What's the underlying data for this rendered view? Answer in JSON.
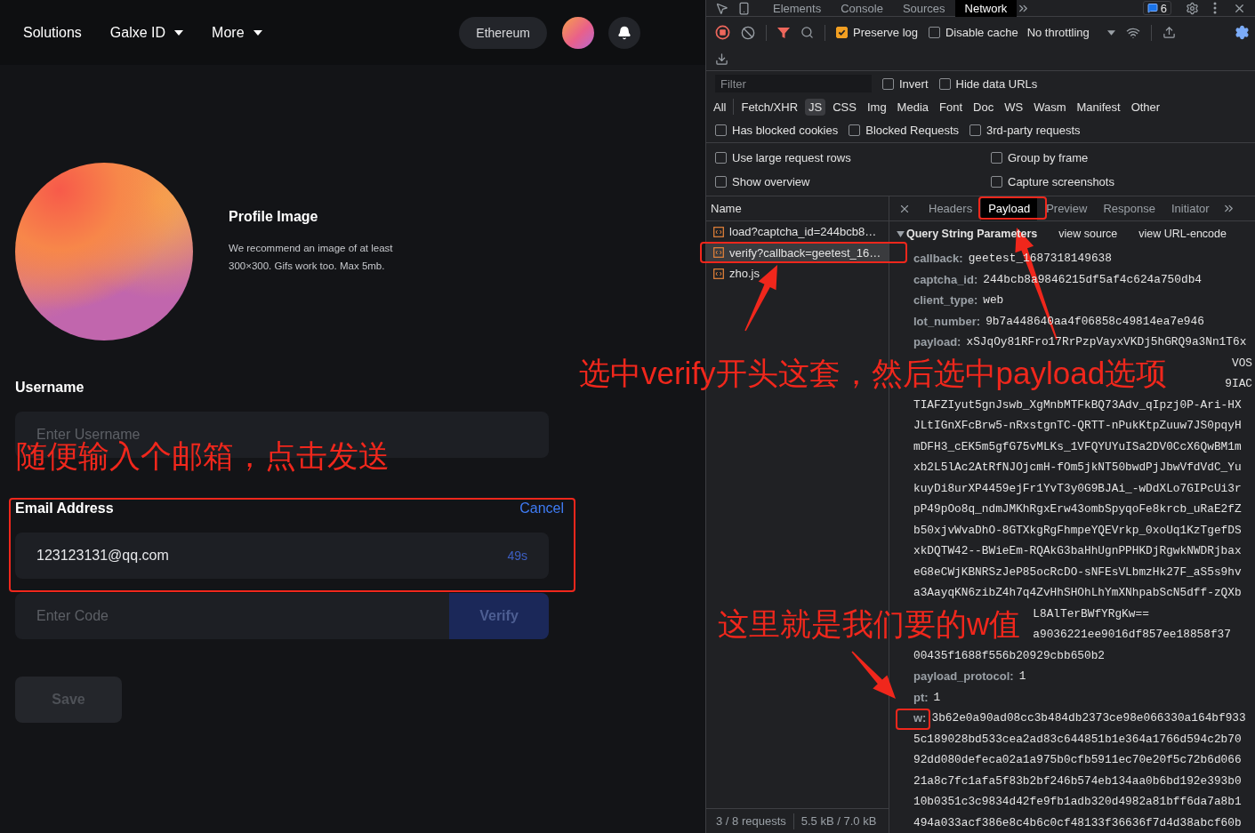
{
  "nav": {
    "links": [
      {
        "label": "Solutions",
        "dropdown": false
      },
      {
        "label": "Galxe ID",
        "dropdown": true
      },
      {
        "label": "More",
        "dropdown": true
      }
    ],
    "network": "Ethereum"
  },
  "profile": {
    "title": "Profile Image",
    "description": "We recommend an image of at least 300×300. Gifs work too. Max 5mb."
  },
  "username": {
    "label": "Username",
    "placeholder": "Enter Username"
  },
  "email": {
    "label": "Email Address",
    "action": "Cancel",
    "value": "123123131@qq.com",
    "countdown": "49s"
  },
  "code": {
    "placeholder": "Enter Code",
    "button": "Verify"
  },
  "save_button": {
    "label": "Save",
    "disabled": true
  },
  "devtools": {
    "tabs": [
      {
        "label": "Elements",
        "selected": false
      },
      {
        "label": "Console",
        "selected": false
      },
      {
        "label": "Sources",
        "selected": false
      },
      {
        "label": "Network",
        "selected": true
      }
    ],
    "issues_count": "6",
    "toolbar": [
      {
        "label": "Preserve log",
        "checked": true
      },
      {
        "label": "Disable cache",
        "checked": false
      }
    ],
    "throttling": "No throttling",
    "filter": {
      "placeholder": "Filter"
    },
    "filter_options": [
      {
        "label": "Invert",
        "checked": false
      },
      {
        "label": "Hide data URLs",
        "checked": false
      }
    ],
    "types": [
      {
        "label": "All",
        "selected": false
      },
      {
        "label": "Fetch/XHR",
        "selected": false
      },
      {
        "label": "JS",
        "selected": true
      },
      {
        "label": "CSS",
        "selected": false
      },
      {
        "label": "Img",
        "selected": false
      },
      {
        "label": "Media",
        "selected": false
      },
      {
        "label": "Font",
        "selected": false
      },
      {
        "label": "Doc",
        "selected": false
      },
      {
        "label": "WS",
        "selected": false
      },
      {
        "label": "Wasm",
        "selected": false
      },
      {
        "label": "Manifest",
        "selected": false
      },
      {
        "label": "Other",
        "selected": false
      }
    ],
    "blocked_options": [
      {
        "label": "Has blocked cookies",
        "checked": false
      },
      {
        "label": "Blocked Requests",
        "checked": false
      },
      {
        "label": "3rd-party requests",
        "checked": false
      }
    ],
    "settings": [
      {
        "label": "Use large request rows",
        "checked": false
      },
      {
        "label": "Group by frame",
        "checked": false
      },
      {
        "label": "Show overview",
        "checked": false
      },
      {
        "label": "Capture screenshots",
        "checked": false
      }
    ],
    "requests": {
      "column": "Name",
      "rows": [
        {
          "name": "load?captcha_id=244bcb8…",
          "selected": false
        },
        {
          "name": "verify?callback=geetest_16…",
          "selected": true
        },
        {
          "name": "zho.js",
          "selected": false
        }
      ]
    },
    "status": {
      "requests": "3 / 8 requests",
      "size": "5.5 kB / 7.0 kB"
    },
    "detail_tabs": [
      {
        "label": "Headers",
        "selected": false
      },
      {
        "label": "Payload",
        "selected": true
      },
      {
        "label": "Preview",
        "selected": false
      },
      {
        "label": "Response",
        "selected": false
      },
      {
        "label": "Initiator",
        "selected": false
      }
    ],
    "payload": {
      "section": "Query String Parameters",
      "expanded": true,
      "links": [
        "view source",
        "view URL-encode"
      ],
      "params": [
        {
          "kind": "param",
          "key": "callback:",
          "lines": [
            "geetest_1687318149638"
          ]
        },
        {
          "kind": "param",
          "key": "captcha_id:",
          "lines": [
            "244bcb8a9846215df5af4c624a750db4"
          ]
        },
        {
          "kind": "param",
          "key": "client_type:",
          "lines": [
            "web"
          ]
        },
        {
          "kind": "param",
          "key": "lot_number:",
          "lines": [
            "9b7a448640aa4f06858c49814ea7e946"
          ]
        },
        {
          "kind": "param",
          "key": "payload:",
          "lines": [
            "xSJqOy81RFro17RrPzpVayxVKDj5hGRQ9a3Nn1T6x"
          ]
        },
        {
          "kind": "note",
          "text": "选中verify开头这套，然后选中payload选项",
          "tails": [
            "VOS",
            "9IAC"
          ]
        },
        {
          "kind": "param",
          "lines": [
            "TIAFZIyut5gnJswb_XgMnbMTFkBQ73Adv_qIpzj0P-Ari-HX",
            "JLtIGnXFcBrw5-nRxstgnTC-QRTT-nPukKtpZuuw7JS0pqyH",
            "mDFH3_cEK5m5gfG75vMLKs_1VFQYUYuISa2DV0CcX6QwBM1m",
            "xb2L5lAc2AtRfNJOjcmH-fOm5jkNT50bwdPjJbwVfdVdC_Yu",
            "kuyDi8urXP4459ejFr1YvT3y0G9BJAi_-wDdXLo7GIPcUi3r",
            "pP49pOo8q_ndmJMKhRgxErw43ombSpyqoFe8krcb_uRaE2fZ",
            "b50xjvWvaDhO-8GTXkgRgFhmpeYQEVrkp_0xoUq1KzTgefDS",
            "xkDQTW42--BWieEm-RQAkG3baHhUgnPPHKDjRgwkNWDRjbax",
            "eG8eCWjKBNRSzJeP85ocRcDO-sNFEsVLbmzHk27F_aS5s9hv",
            "a3AayqKN6zibZ4h7q4ZvHhSHOhLhYmXNhpabScN5dff-zQXb"
          ]
        },
        {
          "kind": "note",
          "text": "这里就是我们要的w值",
          "tails": [
            "L8AlTerBWfYRgKw==",
            "a9036221ee9016df857ee18858f37"
          ]
        },
        {
          "kind": "param",
          "lines": [
            "00435f1688f556b20929cbb650b2"
          ]
        },
        {
          "kind": "param",
          "key": "payload_protocol:",
          "lines": [
            "1"
          ]
        },
        {
          "kind": "param",
          "key": "pt:",
          "lines": [
            "1"
          ]
        },
        {
          "kind": "param",
          "key": "w:",
          "lines": [
            "3b62e0a90ad08cc3b484db2373ce98e066330a164bf933",
            "5c189028bd533cea2ad83c644851b1e364a1766d594c2b70",
            "92dd080defeca02a1a975b0cfb5911ec70e20f5c72b6d066",
            "21a8c7fc1afa5f83b2bf246b574eb134aa0b6bd192e393b0",
            "10b0351c3c9834d42fe9fb1adb320d4982a81bff6da7a8b1",
            "494a033acf386e8c4b6c0cf48133f36636f7d4d38abcf60b"
          ]
        }
      ]
    }
  },
  "annotations": [
    "随便输入个邮箱，点击发送"
  ]
}
